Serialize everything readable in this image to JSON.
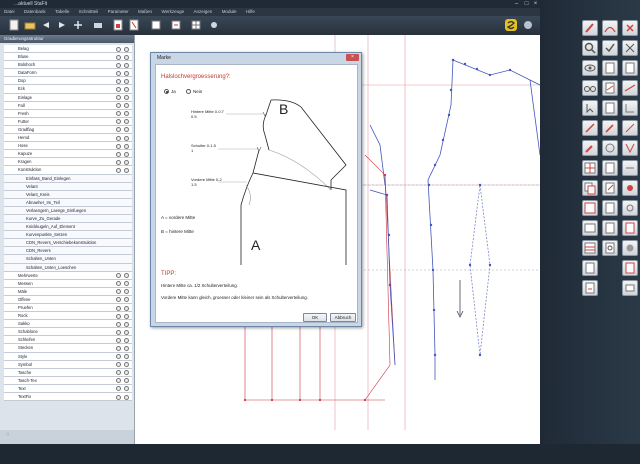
{
  "window": {
    "title": "...aktuell StaFit"
  },
  "menu": [
    "Datei",
    "Datenbank",
    "Tabelle",
    "Schnittteil",
    "Parameter",
    "Maßen",
    "Werkzeuge",
    "Anzeigen",
    "Module",
    "Hilfe"
  ],
  "left_panel": {
    "header": "Gradierungsstruktur",
    "items": [
      {
        "label": "Belag"
      },
      {
        "label": "Bluse"
      },
      {
        "label": "Bolshoch"
      },
      {
        "label": "DataForm"
      },
      {
        "label": "Dop"
      },
      {
        "label": "Eck"
      },
      {
        "label": "Einlage"
      },
      {
        "label": "Fall"
      },
      {
        "label": "Fresh"
      },
      {
        "label": "Futter"
      },
      {
        "label": "Gradflag"
      },
      {
        "label": "Hemd"
      },
      {
        "label": "Hose"
      },
      {
        "label": "Kapuze"
      },
      {
        "label": "Kragen"
      },
      {
        "label": "Konstruktion"
      },
      {
        "label": "Einfass_Band_Einlegen",
        "sub": true
      },
      {
        "label": "Velant",
        "sub": true
      },
      {
        "label": "Velant_Kreis",
        "sub": true
      },
      {
        "label": "Abnaeher_Im_Teil",
        "sub": true
      },
      {
        "label": "Verlaengern_Laenge_Einfuegen",
        "sub": true
      },
      {
        "label": "Kurve_Zu_Gerade",
        "sub": true
      },
      {
        "label": "Knickkugeln_Auf_Element",
        "sub": true
      },
      {
        "label": "Kurvenpunkte_Setzen",
        "sub": true
      },
      {
        "label": "CDN_Revers_Verschiebekonstruktion",
        "sub": true
      },
      {
        "label": "CDN_Revers",
        "sub": true
      },
      {
        "label": "Schalten_Unten",
        "sub": true
      },
      {
        "label": "Schalten_Unten_Loeschen",
        "sub": true
      },
      {
        "label": "Mehrwerte"
      },
      {
        "label": "Messen"
      },
      {
        "label": "Mäle"
      },
      {
        "label": "Offene"
      },
      {
        "label": "Pruefen"
      },
      {
        "label": "Rock"
      },
      {
        "label": "Sakko"
      },
      {
        "label": "Schablone"
      },
      {
        "label": "Schleifen"
      },
      {
        "label": "Stecken"
      },
      {
        "label": "Style"
      },
      {
        "label": "Symbol"
      },
      {
        "label": "Tasche"
      },
      {
        "label": "Tasch-Tex"
      },
      {
        "label": "Text"
      },
      {
        "label": "TextFix"
      }
    ]
  },
  "dialog": {
    "title": "Marke",
    "heading": "Halslochvergroesserung?:",
    "radio_yes": "Ja",
    "radio_no": "Nein",
    "label_big_b": "B",
    "label_big_a": "A",
    "param1_label": "Hintere Mitte 0-0.7",
    "param1_value": "0.5",
    "param2_label": "Schulter 0-1.5",
    "param2_value": "1",
    "param3_label": "Vordere Mitte 0-2",
    "param3_value": "1.5",
    "legend_a": "A = vordere Mitte",
    "legend_b": "B = hintere Mitte",
    "tip_title": "TIPP:",
    "tip_line1": "Hintere Mitte ca. 1/2 Schulterverteilung.",
    "tip_line2": "Vordere Mitte kann gleich, groesser oder kleiner sein als Schulterverteilung.",
    "ok": "OK",
    "cancel": "Abbruch"
  },
  "colors": {
    "accent_red": "#c0392b",
    "dark_chrome": "#1f2a36",
    "pattern_blue": "#5566cc",
    "pattern_red": "#cc3344"
  }
}
